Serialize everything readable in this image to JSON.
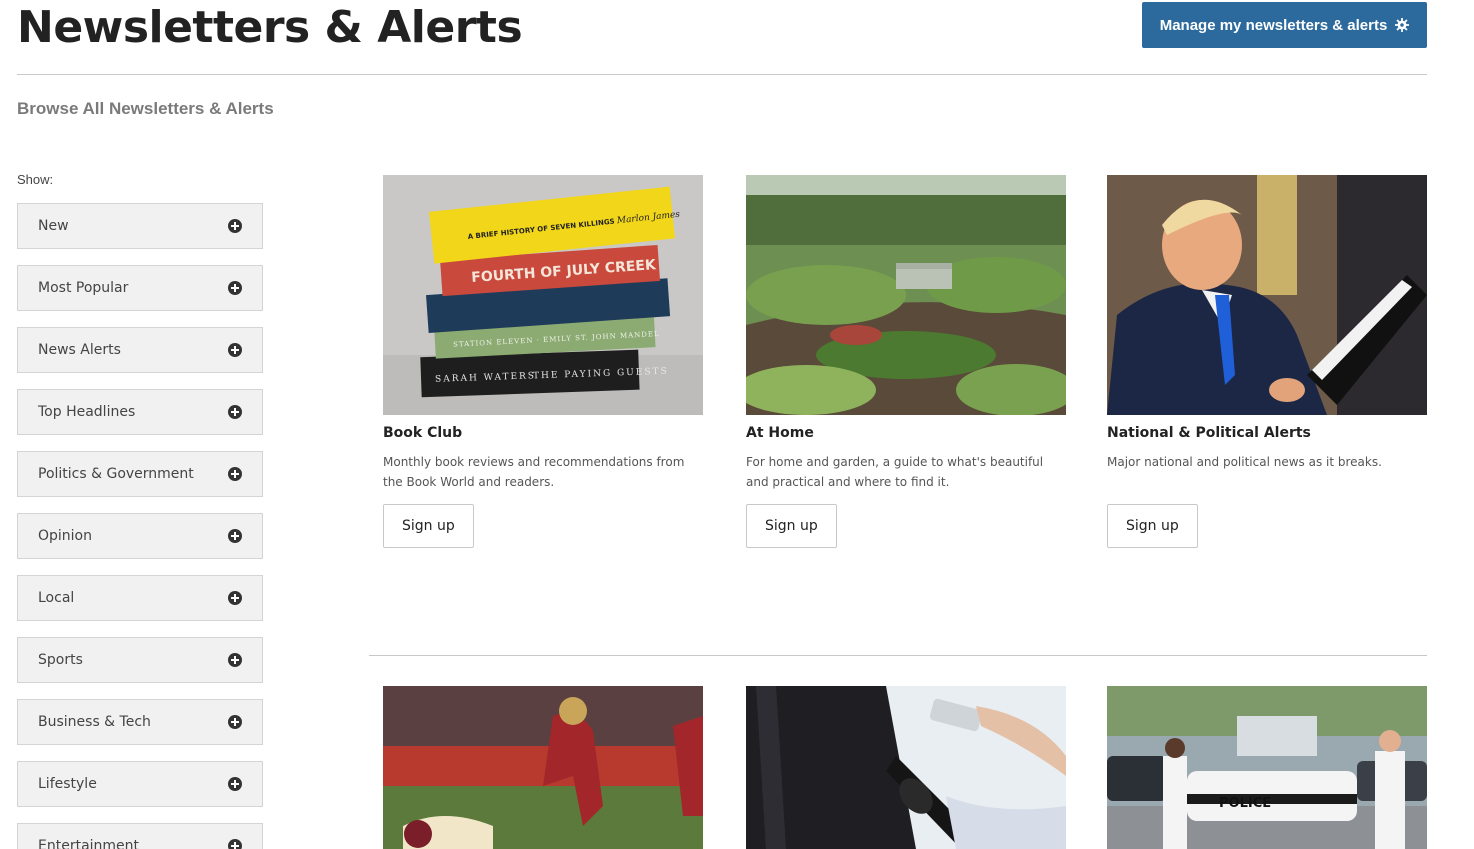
{
  "header": {
    "title": "Newsletters & Alerts",
    "manage_button_label": "Manage my newsletters & alerts"
  },
  "browse_label": "Browse All Newsletters & Alerts",
  "filters": {
    "show_label": "Show:",
    "items": [
      {
        "label": "New"
      },
      {
        "label": "Most Popular"
      },
      {
        "label": "News Alerts"
      },
      {
        "label": "Top Headlines"
      },
      {
        "label": "Politics & Government"
      },
      {
        "label": "Opinion"
      },
      {
        "label": "Local"
      },
      {
        "label": "Sports"
      },
      {
        "label": "Business & Tech"
      },
      {
        "label": "Lifestyle"
      },
      {
        "label": "Entertainment"
      }
    ]
  },
  "cards": [
    {
      "title": "Book Club",
      "description": "Monthly book reviews and recommendations from the Book World and readers.",
      "button_label": "Sign up",
      "book_spines": [
        "A BRIEF HISTORY OF SEVEN KILLINGS",
        "Marlon James",
        "FOURTH OF JULY CREEK",
        "STATION ELEVEN · EMILY ST. JOHN MANDEL",
        "SARAH WATERS",
        "THE PAYING GUESTS"
      ]
    },
    {
      "title": "At Home",
      "description": "For home and garden, a guide to what's beautiful and practical and where to find it.",
      "button_label": "Sign up"
    },
    {
      "title": "National & Political Alerts",
      "description": "Major national and political news as it breaks.",
      "button_label": "Sign up"
    }
  ],
  "second_row": {
    "police_car_text": "POLICE"
  },
  "colors": {
    "accent": "#2c6a9d",
    "filter_bg": "#f1f1f1",
    "rule": "#c8c8c8"
  }
}
